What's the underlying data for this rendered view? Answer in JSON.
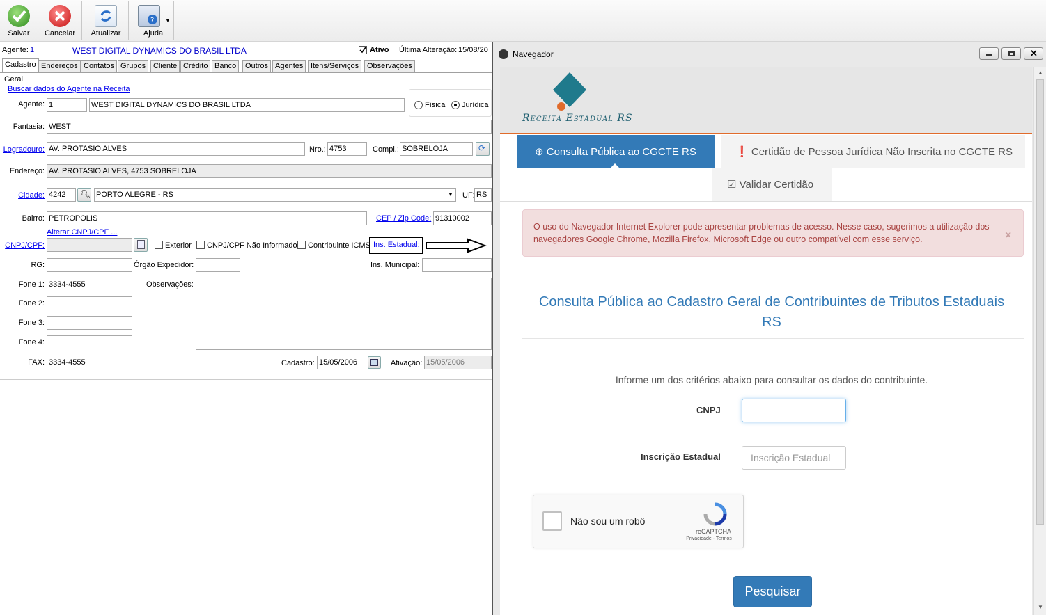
{
  "toolbar": {
    "save": "Salvar",
    "cancel": "Cancelar",
    "refresh": "Atualizar",
    "help": "Ajuda"
  },
  "header": {
    "agent_label": "Agente:",
    "agent_id": "1",
    "agent_name": "WEST DIGITAL DYNAMICS DO BRASIL LTDA",
    "active_label": "Ativo",
    "last_change_label": "Última Alteração:",
    "last_change_value": "15/08/20"
  },
  "tabs": [
    "Cadastro",
    "Endereços",
    "Contatos",
    "Grupos",
    "Cliente",
    "Crédito",
    "Banco",
    "Outros",
    "Agentes",
    "Itens/Serviços",
    "Observações"
  ],
  "form": {
    "group_label": "Geral",
    "fetch_link": "Buscar dados do Agente na Receita",
    "agent_label": "Agente:",
    "agent_code": "1",
    "agent_name": "WEST DIGITAL DYNAMICS DO BRASIL LTDA",
    "fisica": "Física",
    "juridica": "Jurídica",
    "fantasia_label": "Fantasia:",
    "fantasia_value": "WEST",
    "logradouro_label": "Logradouro:",
    "logradouro_value": "AV. PROTASIO ALVES",
    "nro_label": "Nro.:",
    "nro_value": "4753",
    "compl_label": "Compl.:",
    "compl_value": "SOBRELOJA",
    "endereco_label": "Endereço:",
    "endereco_value": "AV. PROTASIO ALVES, 4753 SOBRELOJA",
    "cidade_label": "Cidade:",
    "cidade_code": "4242",
    "cidade_value": "PORTO ALEGRE - RS",
    "uf_label": "UF:",
    "uf_value": "RS",
    "bairro_label": "Bairro:",
    "bairro_value": "PETROPOLIS",
    "cep_label": "CEP / Zip Code:",
    "cep_value": "91310002",
    "alterar_link": "Alterar CNPJ/CPF ...",
    "cnpj_label": "CNPJ/CPF:",
    "exterior": "Exterior",
    "nao_informado": "CNPJ/CPF Não Informado",
    "contribuinte": "Contribuinte ICMS",
    "ins_estadual": "Ins. Estadual:",
    "rg_label": "RG:",
    "orgao_label": "Órgão Expedidor:",
    "ins_municipal": "Ins. Municipal:",
    "fone1_label": "Fone 1:",
    "fone1_value": "3334-4555",
    "fone2_label": "Fone 2:",
    "fone3_label": "Fone 3:",
    "fone4_label": "Fone 4:",
    "obs_label": "Observações:",
    "fax_label": "FAX:",
    "fax_value": "3334-4555",
    "cadastro_label": "Cadastro:",
    "cadastro_value": "15/05/2006",
    "ativacao_label": "Ativação:",
    "ativacao_value": "15/05/2006"
  },
  "browser": {
    "title": "Navegador",
    "logo_text": "Receita Estadual RS",
    "tab1": "Consulta Pública ao CGCTE RS",
    "tab2": "Certidão de Pessoa Jurídica Não Inscrita no CGCTE RS",
    "tab3": "Validar Certidão",
    "alert": "O uso do Navegador Internet Explorer pode apresentar problemas de acesso. Nesse caso, sugerimos a utilização dos navegadores Google Chrome, Mozilla Firefox, Microsoft Edge ou outro compatível com esse serviço.",
    "alert_close": "×",
    "heading": "Consulta Pública ao Cadastro Geral de Contribuintes de Tributos Estaduais RS",
    "instruction": "Informe um dos critérios abaixo para consultar os dados do contribuinte.",
    "cnpj_label": "CNPJ",
    "ie_label": "Inscrição Estadual",
    "ie_placeholder": "Inscrição Estadual",
    "captcha_label": "Não sou um robô",
    "captcha_brand": "reCAPTCHA",
    "captcha_links": "Privacidade - Termos",
    "search_button": "Pesquisar"
  },
  "colors": {
    "accent": "#337ab7",
    "logo_orange": "#e06b2b",
    "logo_teal": "#1f7a8c",
    "alert_bg": "#f2dede",
    "alert_text": "#a94442",
    "link": "#0000ee"
  }
}
